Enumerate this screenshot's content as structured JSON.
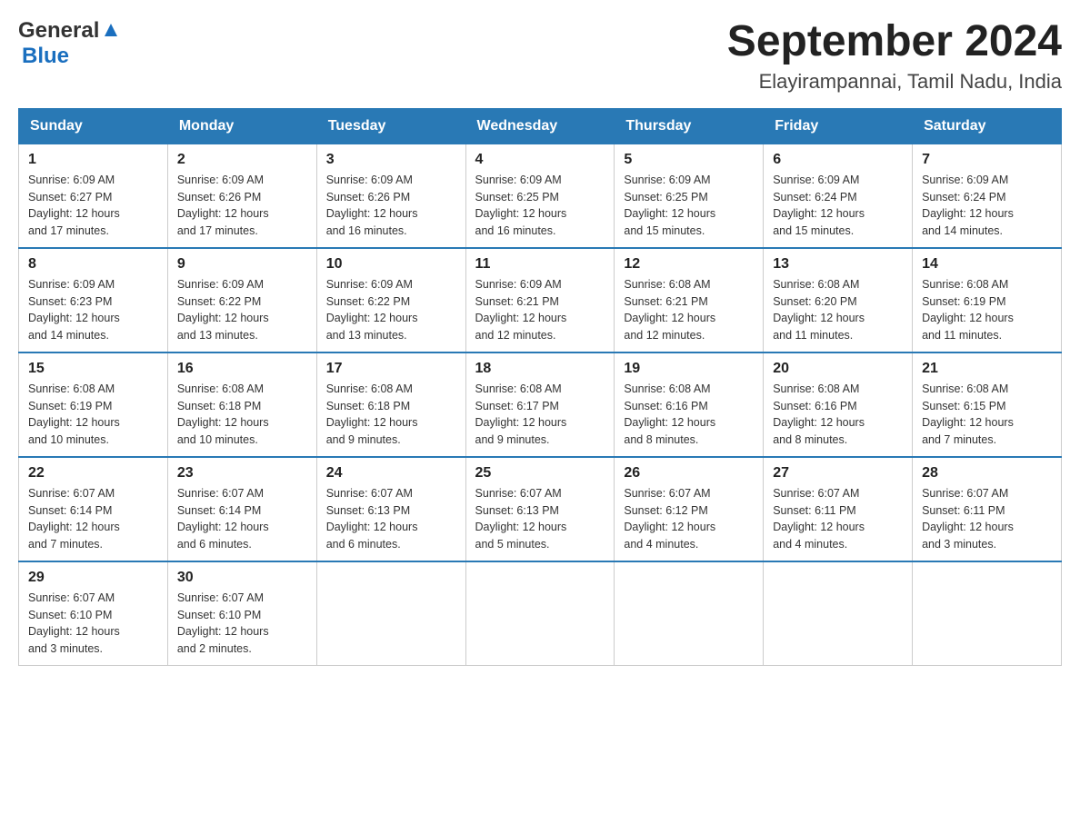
{
  "header": {
    "logo_general": "General",
    "logo_blue": "Blue",
    "month_title": "September 2024",
    "location": "Elayirampannai, Tamil Nadu, India"
  },
  "weekdays": [
    "Sunday",
    "Monday",
    "Tuesday",
    "Wednesday",
    "Thursday",
    "Friday",
    "Saturday"
  ],
  "weeks": [
    [
      {
        "day": "1",
        "sunrise": "6:09 AM",
        "sunset": "6:27 PM",
        "daylight": "12 hours and 17 minutes."
      },
      {
        "day": "2",
        "sunrise": "6:09 AM",
        "sunset": "6:26 PM",
        "daylight": "12 hours and 17 minutes."
      },
      {
        "day": "3",
        "sunrise": "6:09 AM",
        "sunset": "6:26 PM",
        "daylight": "12 hours and 16 minutes."
      },
      {
        "day": "4",
        "sunrise": "6:09 AM",
        "sunset": "6:25 PM",
        "daylight": "12 hours and 16 minutes."
      },
      {
        "day": "5",
        "sunrise": "6:09 AM",
        "sunset": "6:25 PM",
        "daylight": "12 hours and 15 minutes."
      },
      {
        "day": "6",
        "sunrise": "6:09 AM",
        "sunset": "6:24 PM",
        "daylight": "12 hours and 15 minutes."
      },
      {
        "day": "7",
        "sunrise": "6:09 AM",
        "sunset": "6:24 PM",
        "daylight": "12 hours and 14 minutes."
      }
    ],
    [
      {
        "day": "8",
        "sunrise": "6:09 AM",
        "sunset": "6:23 PM",
        "daylight": "12 hours and 14 minutes."
      },
      {
        "day": "9",
        "sunrise": "6:09 AM",
        "sunset": "6:22 PM",
        "daylight": "12 hours and 13 minutes."
      },
      {
        "day": "10",
        "sunrise": "6:09 AM",
        "sunset": "6:22 PM",
        "daylight": "12 hours and 13 minutes."
      },
      {
        "day": "11",
        "sunrise": "6:09 AM",
        "sunset": "6:21 PM",
        "daylight": "12 hours and 12 minutes."
      },
      {
        "day": "12",
        "sunrise": "6:08 AM",
        "sunset": "6:21 PM",
        "daylight": "12 hours and 12 minutes."
      },
      {
        "day": "13",
        "sunrise": "6:08 AM",
        "sunset": "6:20 PM",
        "daylight": "12 hours and 11 minutes."
      },
      {
        "day": "14",
        "sunrise": "6:08 AM",
        "sunset": "6:19 PM",
        "daylight": "12 hours and 11 minutes."
      }
    ],
    [
      {
        "day": "15",
        "sunrise": "6:08 AM",
        "sunset": "6:19 PM",
        "daylight": "12 hours and 10 minutes."
      },
      {
        "day": "16",
        "sunrise": "6:08 AM",
        "sunset": "6:18 PM",
        "daylight": "12 hours and 10 minutes."
      },
      {
        "day": "17",
        "sunrise": "6:08 AM",
        "sunset": "6:18 PM",
        "daylight": "12 hours and 9 minutes."
      },
      {
        "day": "18",
        "sunrise": "6:08 AM",
        "sunset": "6:17 PM",
        "daylight": "12 hours and 9 minutes."
      },
      {
        "day": "19",
        "sunrise": "6:08 AM",
        "sunset": "6:16 PM",
        "daylight": "12 hours and 8 minutes."
      },
      {
        "day": "20",
        "sunrise": "6:08 AM",
        "sunset": "6:16 PM",
        "daylight": "12 hours and 8 minutes."
      },
      {
        "day": "21",
        "sunrise": "6:08 AM",
        "sunset": "6:15 PM",
        "daylight": "12 hours and 7 minutes."
      }
    ],
    [
      {
        "day": "22",
        "sunrise": "6:07 AM",
        "sunset": "6:14 PM",
        "daylight": "12 hours and 7 minutes."
      },
      {
        "day": "23",
        "sunrise": "6:07 AM",
        "sunset": "6:14 PM",
        "daylight": "12 hours and 6 minutes."
      },
      {
        "day": "24",
        "sunrise": "6:07 AM",
        "sunset": "6:13 PM",
        "daylight": "12 hours and 6 minutes."
      },
      {
        "day": "25",
        "sunrise": "6:07 AM",
        "sunset": "6:13 PM",
        "daylight": "12 hours and 5 minutes."
      },
      {
        "day": "26",
        "sunrise": "6:07 AM",
        "sunset": "6:12 PM",
        "daylight": "12 hours and 4 minutes."
      },
      {
        "day": "27",
        "sunrise": "6:07 AM",
        "sunset": "6:11 PM",
        "daylight": "12 hours and 4 minutes."
      },
      {
        "day": "28",
        "sunrise": "6:07 AM",
        "sunset": "6:11 PM",
        "daylight": "12 hours and 3 minutes."
      }
    ],
    [
      {
        "day": "29",
        "sunrise": "6:07 AM",
        "sunset": "6:10 PM",
        "daylight": "12 hours and 3 minutes."
      },
      {
        "day": "30",
        "sunrise": "6:07 AM",
        "sunset": "6:10 PM",
        "daylight": "12 hours and 2 minutes."
      },
      null,
      null,
      null,
      null,
      null
    ]
  ]
}
